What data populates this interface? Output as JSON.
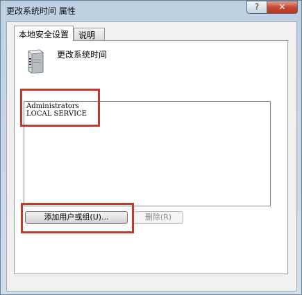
{
  "window": {
    "title": "更改系统时间 属性",
    "help_label": "?",
    "close_label": "✕"
  },
  "tabs": [
    {
      "label": "本地安全设置"
    },
    {
      "label": "说明"
    }
  ],
  "policy": {
    "name": "更改系统时间",
    "icon": "server-icon"
  },
  "accounts": [
    "Administrators",
    "LOCAL SERVICE"
  ],
  "buttons": {
    "add_label": "添加用户或组(U)...",
    "remove_label": "删除(R)"
  },
  "colors": {
    "highlight": "#c0392b"
  }
}
